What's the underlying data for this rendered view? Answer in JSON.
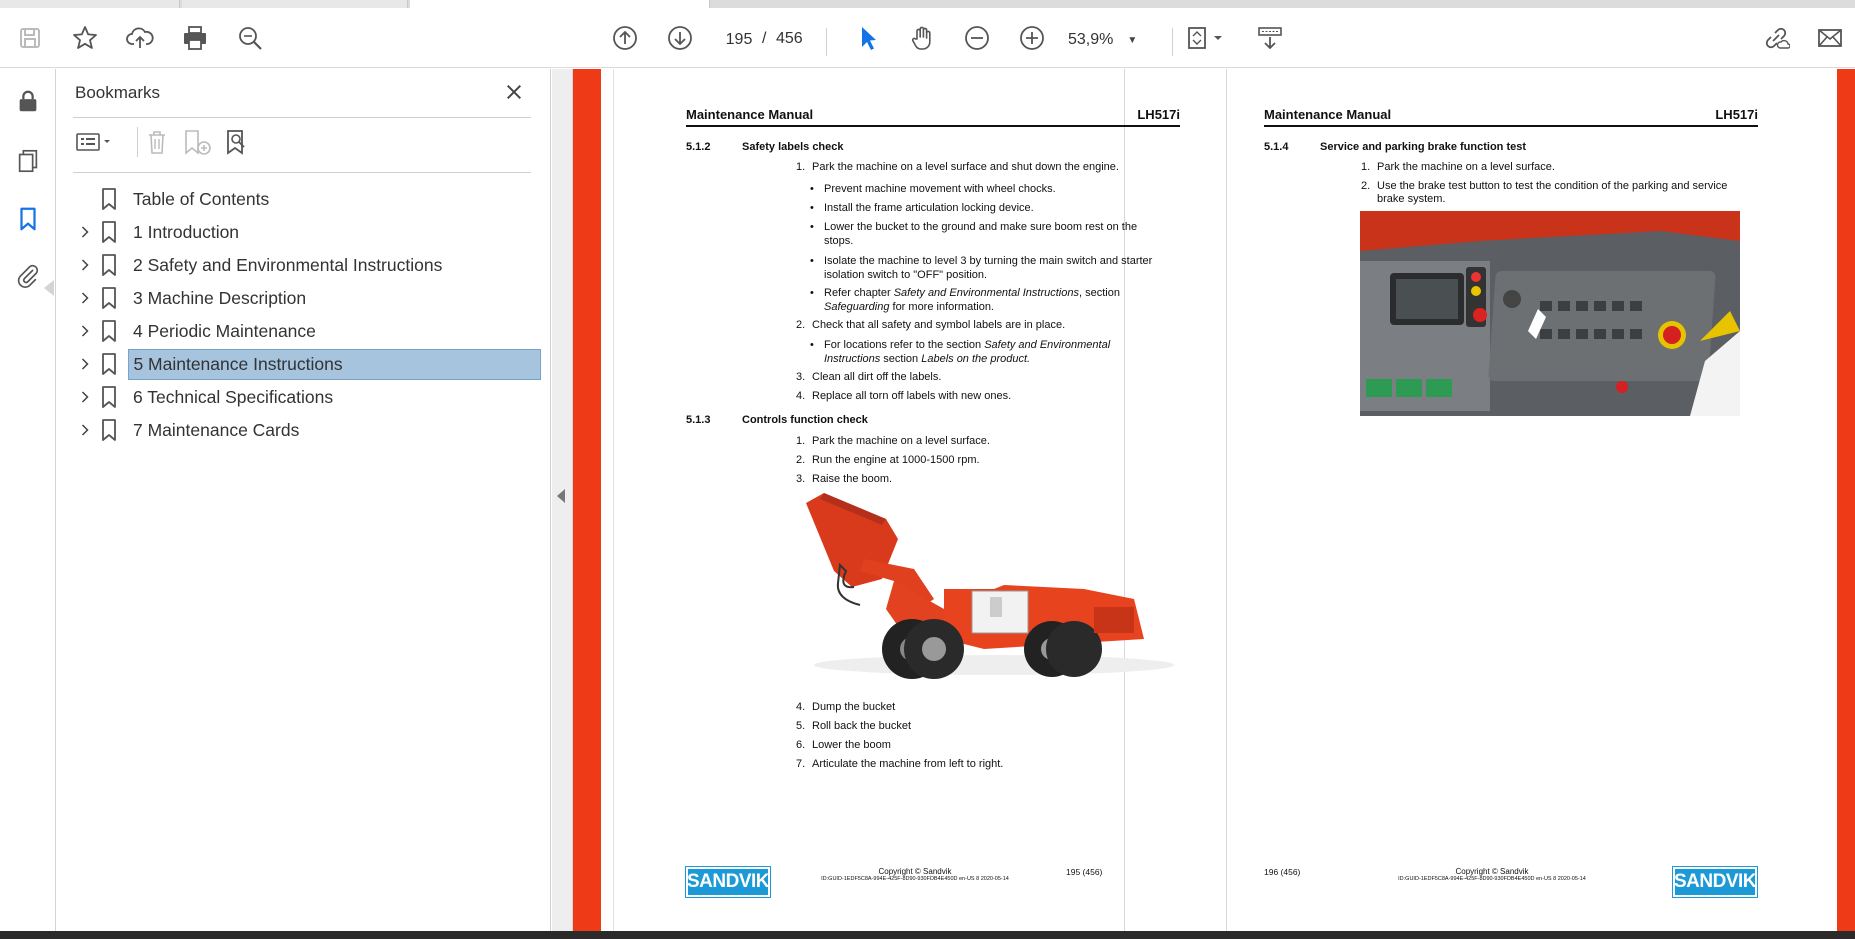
{
  "toolbar": {
    "page_current": "195",
    "page_separator": "/",
    "page_total": "456",
    "zoom": "53,9%",
    "icons": [
      "save-icon",
      "star-icon",
      "cloud-upload-icon",
      "print-icon",
      "zoom-search-icon",
      "page-up-icon",
      "page-down-icon",
      "select-cursor-icon",
      "hand-icon",
      "zoom-out-icon",
      "zoom-in-icon",
      "page-fit-icon",
      "scroll-mode-icon",
      "link-cloud-icon",
      "mail-icon"
    ]
  },
  "panel": {
    "title": "Bookmarks",
    "items": [
      {
        "label": "Table of Contents",
        "expandable": false,
        "selected": false
      },
      {
        "label": "1 Introduction",
        "expandable": true,
        "selected": false
      },
      {
        "label": "2 Safety and Environmental Instructions",
        "expandable": true,
        "selected": false
      },
      {
        "label": "3 Machine Description",
        "expandable": true,
        "selected": false
      },
      {
        "label": "4 Periodic Maintenance",
        "expandable": true,
        "selected": false
      },
      {
        "label": "5 Maintenance Instructions",
        "expandable": true,
        "selected": true
      },
      {
        "label": "6 Technical Specifications",
        "expandable": true,
        "selected": false
      },
      {
        "label": "7 Maintenance Cards",
        "expandable": true,
        "selected": false
      }
    ]
  },
  "page1": {
    "header_left": "Maintenance Manual",
    "header_right": "LH517i",
    "s512_num": "5.1.2",
    "s512_title": "Safety labels check",
    "s512_items": [
      "Park the machine on a level surface and shut down the engine."
    ],
    "s512_bullets": [
      "Prevent machine movement with wheel chocks.",
      "Install the frame articulation locking device.",
      "Lower the bucket to the ground and make sure boom rest on the stops.",
      "Isolate the machine to level 3 by turning the main switch and starter isolation switch to \"OFF\" position."
    ],
    "refer_a": "Refer chapter ",
    "refer_b": "Safety and Environmental Instructions",
    "refer_c": ", section ",
    "refer_d": "Safeguarding",
    "refer_e": " for more information.",
    "s512_item2": "Check that all safety and symbol labels are in place.",
    "loc_a": "For locations refer to the section ",
    "loc_b": "Safety and Environmental Instructions",
    "loc_c": " section ",
    "loc_d": "Labels on the product.",
    "s512_item3": "Clean all dirt off the labels.",
    "s512_item4": "Replace all torn off labels with new ones.",
    "s513_num": "5.1.3",
    "s513_title": "Controls function check",
    "s513_items": [
      "Park the machine on a level surface.",
      "Run the engine at 1000-1500 rpm.",
      "Raise the boom."
    ],
    "s513_items_b": [
      "Dump the bucket",
      "Roll back the bucket",
      "Lower the boom",
      "Articulate the machine from left to right."
    ],
    "footer_logo": "SANDVIK",
    "footer_copyright": "Copyright © Sandvik",
    "footer_id": "ID:GUID-1EDF5C8A-994E-425F-8D90-930FDB4E450D en-US 8 2020-05-14",
    "footer_page": "195 (456)"
  },
  "page2": {
    "header_left": "Maintenance Manual",
    "header_right": "LH517i",
    "s514_num": "5.1.4",
    "s514_title": "Service and parking brake function test",
    "s514_items": [
      "Park the machine on a level surface.",
      "Use the brake test button to test the condition of the parking and service brake system."
    ],
    "footer_logo": "SANDVIK",
    "footer_copyright": "Copyright © Sandvik",
    "footer_id": "ID:GUID-1EDF5C8A-994E-425F-8D90-930FDB4E450D en-US 8 2020-05-14",
    "footer_page": "196 (456)"
  },
  "colors": {
    "accent_red": "#ee3a16",
    "selection": "#a7c4df",
    "sandvik_blue": "#1c9ad7",
    "icon_blue": "#1473e6"
  }
}
